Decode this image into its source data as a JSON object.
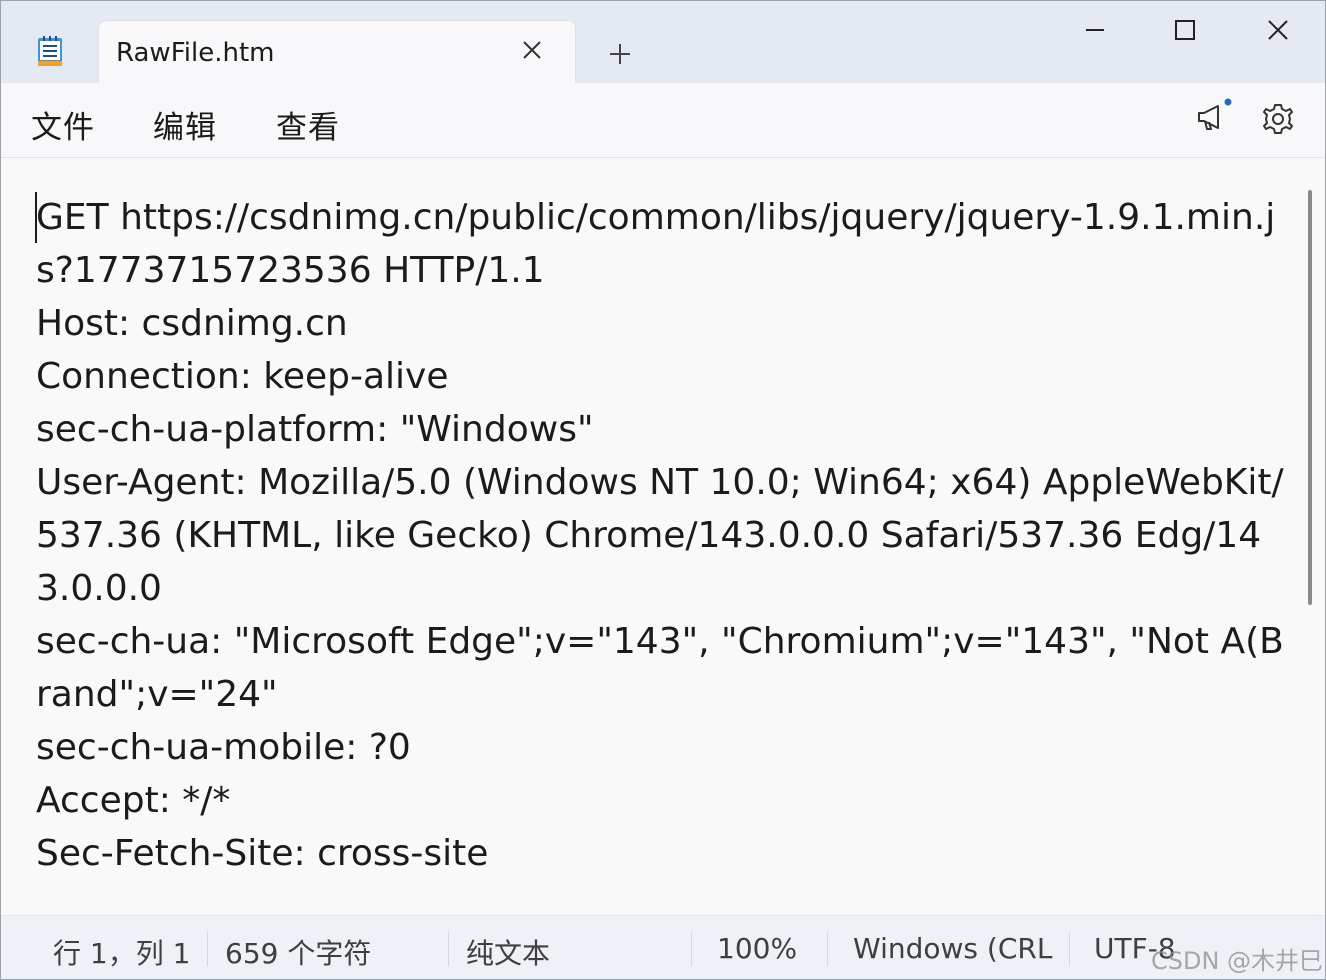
{
  "tab": {
    "title": "RawFile.htm"
  },
  "menu": {
    "file": "文件",
    "edit": "编辑",
    "view": "查看"
  },
  "editor": {
    "content": "GET https://csdnimg.cn/public/common/libs/jquery/jquery-1.9.1.min.js?1773715723536 HTTP/1.1\nHost: csdnimg.cn\nConnection: keep-alive\nsec-ch-ua-platform: \"Windows\"\nUser-Agent: Mozilla/5.0 (Windows NT 10.0; Win64; x64) AppleWebKit/537.36 (KHTML, like Gecko) Chrome/143.0.0.0 Safari/537.36 Edg/143.0.0.0\nsec-ch-ua: \"Microsoft Edge\";v=\"143\", \"Chromium\";v=\"143\", \"Not A(Brand\";v=\"24\"\nsec-ch-ua-mobile: ?0\nAccept: */*\nSec-Fetch-Site: cross-site"
  },
  "status": {
    "position": "行 1，列 1",
    "char_count": "659 个字符",
    "format": "纯文本",
    "zoom": "100%",
    "line_ending": "Windows (CRLF",
    "encoding": "UTF-8"
  },
  "watermark": "CSDN @木井巳",
  "icons": {
    "app": "notepad-icon",
    "tab_close": "close-icon",
    "new_tab": "plus-icon",
    "minimize": "minimize-icon",
    "maximize": "maximize-icon",
    "close_window": "close-icon",
    "feedback": "megaphone-icon",
    "settings": "gear-icon"
  },
  "colors": {
    "titlebar": "#e4e9f2",
    "editor_bg": "#f9f9f9",
    "notification_dot": "#2b6cb0"
  }
}
